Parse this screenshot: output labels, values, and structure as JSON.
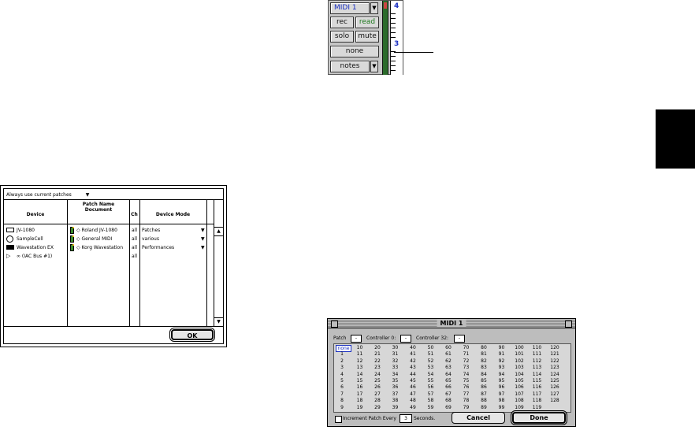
{
  "strip": {
    "midi_label": "MIDI 1",
    "rec_label": "rec",
    "read_label": "read",
    "solo_label": "solo",
    "mute_label": "mute",
    "none_label": "none",
    "notes_label": "notes",
    "scale_top": "4",
    "scale_mid": "3"
  },
  "patch_dialog": {
    "dropdown_label": "Always use current patches",
    "headers": {
      "device": "Device",
      "patch_name_document": "Patch Name Document",
      "ch": "Ch",
      "device_mode": "Device Mode"
    },
    "rows": [
      {
        "device": "JV-1080",
        "document": "◇ Roland JV-1080",
        "ch": "all",
        "mode": "Patches"
      },
      {
        "device": "SampleCell",
        "document": "◇ General MIDI",
        "ch": "all",
        "mode": "various"
      },
      {
        "device": "Wavestation EX",
        "document": "◇ Korg Wavestation",
        "ch": "all",
        "mode": "Performances"
      },
      {
        "device": "∞ (IAC Bus #1)",
        "document": "",
        "ch": "all",
        "mode": ""
      }
    ],
    "ok_label": "OK"
  },
  "midi_window": {
    "title": "MIDI 1",
    "patch_label": "Patch",
    "patch_value": "-",
    "controller0_label": "Controller 0:",
    "controller0_value": "-",
    "controller32_label": "Controller 32:",
    "controller32_value": "-",
    "grid_rows": [
      [
        "none",
        "10",
        "20",
        "30",
        "40",
        "50",
        "60",
        "70",
        "80",
        "90",
        "100",
        "110",
        "120"
      ],
      [
        "1",
        "11",
        "21",
        "31",
        "41",
        "51",
        "61",
        "71",
        "81",
        "91",
        "101",
        "111",
        "121"
      ],
      [
        "2",
        "12",
        "22",
        "32",
        "42",
        "52",
        "62",
        "72",
        "82",
        "92",
        "102",
        "112",
        "122"
      ],
      [
        "3",
        "13",
        "23",
        "33",
        "43",
        "53",
        "63",
        "73",
        "83",
        "93",
        "103",
        "113",
        "123"
      ],
      [
        "4",
        "14",
        "24",
        "34",
        "44",
        "54",
        "64",
        "74",
        "84",
        "94",
        "104",
        "114",
        "124"
      ],
      [
        "5",
        "15",
        "25",
        "35",
        "45",
        "55",
        "65",
        "75",
        "85",
        "95",
        "105",
        "115",
        "125"
      ],
      [
        "6",
        "16",
        "26",
        "36",
        "46",
        "56",
        "66",
        "76",
        "86",
        "96",
        "106",
        "116",
        "126"
      ],
      [
        "7",
        "17",
        "27",
        "37",
        "47",
        "57",
        "67",
        "77",
        "87",
        "97",
        "107",
        "117",
        "127"
      ],
      [
        "8",
        "18",
        "28",
        "38",
        "48",
        "58",
        "68",
        "78",
        "88",
        "98",
        "108",
        "118",
        "128"
      ],
      [
        "9",
        "19",
        "29",
        "39",
        "49",
        "59",
        "69",
        "79",
        "89",
        "99",
        "109",
        "119",
        ""
      ]
    ],
    "increment_label": "Increment Patch Every",
    "seconds_value": "3",
    "seconds_label": "Seconds.",
    "cancel_label": "Cancel",
    "done_label": "Done"
  }
}
